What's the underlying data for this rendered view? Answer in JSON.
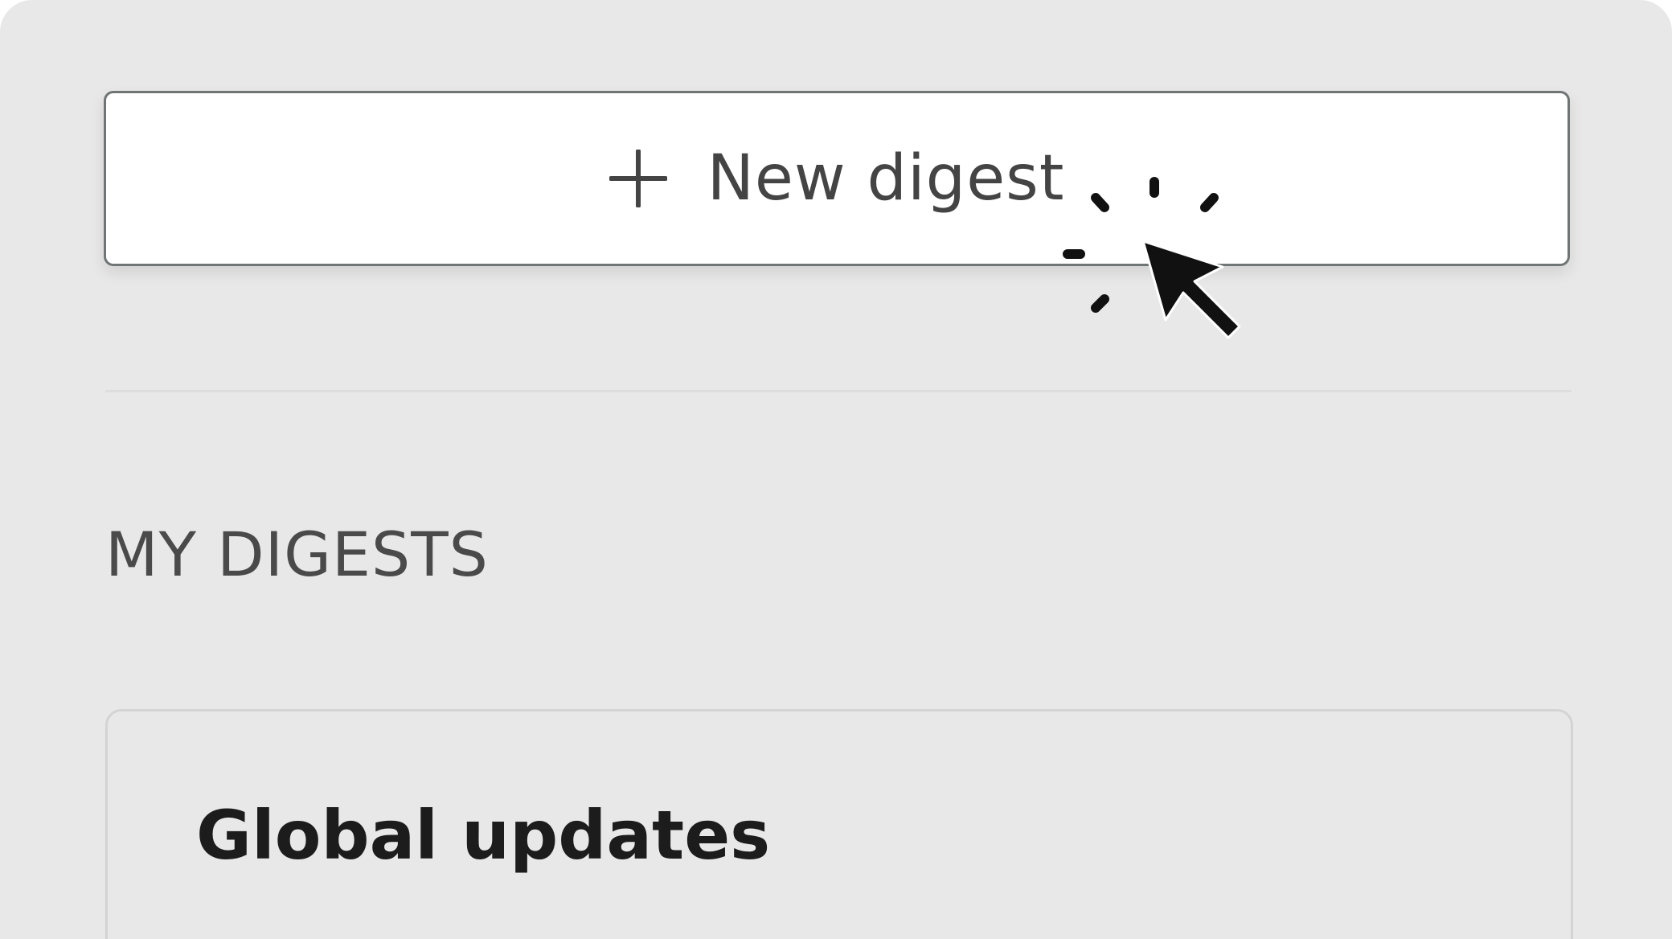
{
  "new_digest_button": {
    "label": "New digest",
    "icon": "plus-icon"
  },
  "section": {
    "title": "MY DIGESTS"
  },
  "digests": [
    {
      "title": "Global updates"
    }
  ],
  "colors": {
    "panel_background": "#e8e8e8",
    "button_background": "#ffffff",
    "button_border": "#6f7474",
    "text_muted": "#444444",
    "text_strong": "#1c1c1c",
    "cursor": "#111111"
  },
  "cursor": {
    "icon": "pointer-cursor-icon",
    "effect": "click-burst-icon"
  }
}
